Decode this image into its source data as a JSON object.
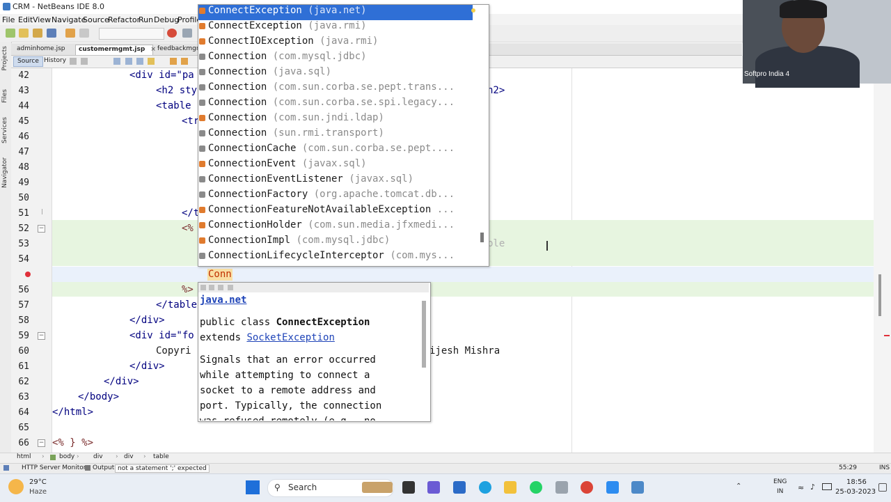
{
  "window": {
    "title": "CRM - NetBeans IDE 8.0"
  },
  "menu": [
    "File",
    "Edit",
    "View",
    "Navigate",
    "Source",
    "Refactor",
    "Run",
    "Debug",
    "Profile"
  ],
  "side_tabs": [
    "Projects",
    "Files",
    "Services",
    "Navigator"
  ],
  "tabs": [
    "adminhome.jsp",
    "customermgmt.jsp",
    "feedbackmgr"
  ],
  "editor_toolbar": {
    "source": "Source",
    "history": "History"
  },
  "lines": [
    "42",
    "43",
    "44",
    "45",
    "46",
    "47",
    "48",
    "49",
    "50",
    "51",
    "52",
    "53",
    "54",
    "55",
    "56",
    "57",
    "58",
    "59",
    "60",
    "61",
    "62",
    "63",
    "64",
    "65",
    "66"
  ],
  "code": {
    "l42": "<div id=\"pa",
    "l43": "<h2 sty",
    "l43r": "h2>",
    "l44": "<table",
    "l45": "<tr",
    "l51": "</t",
    "l52": "<%",
    "l53r": "ble",
    "l56": "%>",
    "l57": "</table",
    "l58": "</div>",
    "l59": "<div id=\"fo",
    "l60": "Copyri",
    "l60r": "ijesh Mishra",
    "l61": "</div>",
    "l62": "</div>",
    "l63": "</body>",
    "l64": "</html>",
    "l66": "<% } %>"
  },
  "typed_token": "Conn",
  "completion": [
    {
      "name": "ConnectException",
      "pkg": "(java.net)",
      "kind": "class"
    },
    {
      "name": "ConnectException",
      "pkg": "(java.rmi)",
      "kind": "class"
    },
    {
      "name": "ConnectIOException",
      "pkg": "(java.rmi)",
      "kind": "class"
    },
    {
      "name": "Connection",
      "pkg": "(com.mysql.jdbc)",
      "kind": "interface"
    },
    {
      "name": "Connection",
      "pkg": "(java.sql)",
      "kind": "interface"
    },
    {
      "name": "Connection",
      "pkg": "(com.sun.corba.se.pept.trans...",
      "kind": "interface"
    },
    {
      "name": "Connection",
      "pkg": "(com.sun.corba.se.spi.legacy...",
      "kind": "interface"
    },
    {
      "name": "Connection",
      "pkg": "(com.sun.jndi.ldap)",
      "kind": "class"
    },
    {
      "name": "Connection",
      "pkg": "(sun.rmi.transport)",
      "kind": "interface"
    },
    {
      "name": "ConnectionCache",
      "pkg": "(com.sun.corba.se.pept....",
      "kind": "interface"
    },
    {
      "name": "ConnectionEvent",
      "pkg": "(javax.sql)",
      "kind": "class"
    },
    {
      "name": "ConnectionEventListener",
      "pkg": "(javax.sql)",
      "kind": "interface"
    },
    {
      "name": "ConnectionFactory",
      "pkg": "(org.apache.tomcat.db...",
      "kind": "interface"
    },
    {
      "name": "ConnectionFeatureNotAvailableException",
      "pkg": "...",
      "kind": "class"
    },
    {
      "name": "ConnectionHolder",
      "pkg": "(com.sun.media.jfxmedi...",
      "kind": "class"
    },
    {
      "name": "ConnectionImpl",
      "pkg": "(com.mysql.jdbc)",
      "kind": "class"
    },
    {
      "name": "ConnectionLifecycleInterceptor",
      "pkg": "(com.mys...",
      "kind": "interface"
    }
  ],
  "docs": {
    "package": "java.net",
    "decl_prefix": "public class ",
    "decl_name": "ConnectException",
    "extends_kw": "extends ",
    "extends_link": "SocketException",
    "body": [
      "Signals that an error occurred",
      "while attempting to connect a",
      "socket to a remote address and",
      "port. Typically, the connection",
      "was refused remotely (e.g., no"
    ]
  },
  "webcam": {
    "label": "Softpro India 4"
  },
  "breadcrumbs": [
    "html",
    "body",
    "div",
    "div",
    "table"
  ],
  "status": {
    "http_monitor": "HTTP Server Monitor",
    "output": "Output",
    "message": "not a statement ';' expected",
    "position": "55:29",
    "mode": "INS"
  },
  "taskbar": {
    "temp": "29°C",
    "weather": "Haze",
    "search": "Search",
    "lang1": "ENG",
    "lang2": "IN",
    "time": "18:56",
    "date": "25-03-2023"
  },
  "colors": {
    "selection": "#2f6fd6",
    "class_icon": "#e07b2e",
    "interface_icon": "#8a8a8a",
    "fold_highlight": "#e7f5e0"
  }
}
